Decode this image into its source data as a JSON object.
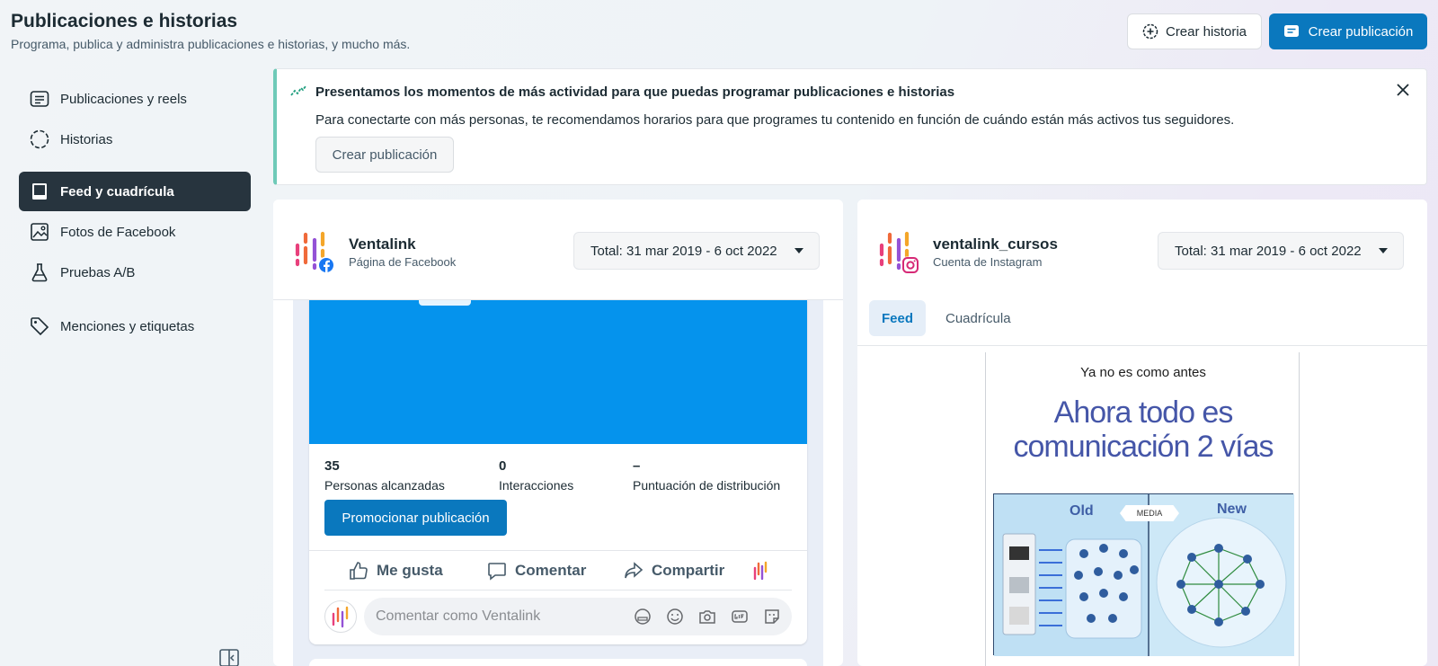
{
  "header": {
    "title": "Publicaciones e historias",
    "subtitle": "Programa, publica y administra publicaciones e historias, y mucho más.",
    "create_story": "Crear historia",
    "create_post": "Crear publicación"
  },
  "sidebar": {
    "items": [
      {
        "label": "Publicaciones y reels",
        "icon": "posts-icon"
      },
      {
        "label": "Historias",
        "icon": "stories-icon"
      },
      {
        "label": "Feed y cuadrícula",
        "icon": "feed-grid-icon",
        "active": true
      },
      {
        "label": "Fotos de Facebook",
        "icon": "photos-icon"
      },
      {
        "label": "Pruebas A/B",
        "icon": "flask-icon"
      },
      {
        "label": "Menciones y etiquetas",
        "icon": "tag-icon"
      }
    ]
  },
  "banner": {
    "title": "Presentamos los momentos de más actividad para que puedas programar publicaciones e historias",
    "text": "Para conectarte con más personas, te recomendamos horarios para que programes tu contenido en función de cuándo están más activos tus seguidores.",
    "button": "Crear publicación"
  },
  "facebook": {
    "name": "Ventalink",
    "type": "Página de Facebook",
    "date_range": "Total: 31 mar 2019 - 6 oct 2022",
    "post": {
      "metrics": [
        {
          "value": "35",
          "label": "Personas alcanzadas"
        },
        {
          "value": "0",
          "label": "Interacciones"
        },
        {
          "value": "–",
          "label": "Puntuación de distribución"
        }
      ],
      "promote": "Promocionar publicación",
      "like": "Me gusta",
      "comment": "Comentar",
      "share": "Compartir",
      "comment_placeholder": "Comentar como Ventalink"
    }
  },
  "instagram": {
    "name": "ventalink_cursos",
    "type": "Cuenta de Instagram",
    "date_range": "Total: 31 mar 2019 - 6 oct 2022",
    "tabs": [
      "Feed",
      "Cuadrícula"
    ],
    "post": {
      "caption": "Ya no es como antes",
      "headline_1": "Ahora todo es",
      "headline_2": "comunicación 2 vías",
      "diagram_old": "Old",
      "diagram_media": "MEDIA",
      "diagram_new": "New"
    }
  },
  "colors": {
    "accent": "#0a78be",
    "sidebar_active": "#27343e",
    "banner_border": "#6fcab8",
    "post_image": "#0593ed"
  }
}
